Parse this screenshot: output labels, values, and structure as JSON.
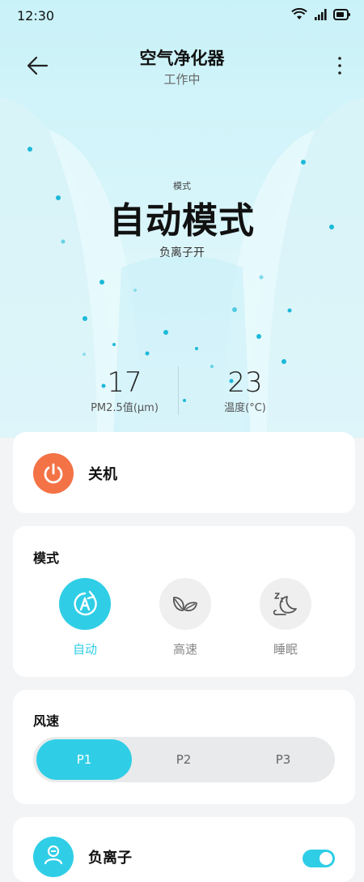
{
  "status_bar": {
    "time": "12:30"
  },
  "header": {
    "title": "空气净化器",
    "subtitle": "工作中"
  },
  "hero": {
    "mode_caption": "模式",
    "mode_name": "自动模式",
    "mode_detail": "负离子开",
    "metrics": [
      {
        "value": "17",
        "label": "PM2.5值(μm)"
      },
      {
        "value": "23",
        "label": "温度(°C)"
      }
    ]
  },
  "power": {
    "label": "关机"
  },
  "mode_section": {
    "title": "模式",
    "options": [
      {
        "label": "自动",
        "icon": "auto-icon",
        "active": true
      },
      {
        "label": "高速",
        "icon": "leaf-icon",
        "active": false
      },
      {
        "label": "睡眠",
        "icon": "moon-icon",
        "active": false
      }
    ]
  },
  "fan_section": {
    "title": "风速",
    "options": [
      {
        "label": "P1",
        "active": true
      },
      {
        "label": "P2",
        "active": false
      },
      {
        "label": "P3",
        "active": false
      }
    ]
  },
  "ion_section": {
    "label": "负离子",
    "enabled": true
  },
  "colors": {
    "accent": "#2fcee6",
    "power": "#f37346",
    "background": "#f2f4f6"
  }
}
